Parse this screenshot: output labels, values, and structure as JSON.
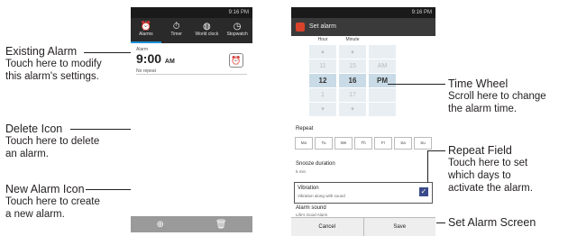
{
  "annotations": {
    "existing_alarm": {
      "title": "Existing Alarm",
      "desc1": "Touch here to modify",
      "desc2": "this alarm's settings."
    },
    "delete_icon": {
      "title": "Delete Icon",
      "desc1": "Touch here to delete",
      "desc2": "an alarm."
    },
    "new_alarm_icon": {
      "title": "New Alarm Icon",
      "desc1": "Touch here to create",
      "desc2": "a new alarm."
    },
    "time_wheel": {
      "title": "Time Wheel",
      "desc1": "Scroll here to change",
      "desc2": "the alarm time."
    },
    "repeat_field": {
      "title": "Repeat Field",
      "desc1": "Touch here to set",
      "desc2": "which days to",
      "desc3": "activate the alarm."
    },
    "set_alarm_screen": {
      "title": "Set Alarm Screen"
    }
  },
  "phone1": {
    "status": "9:16 PM",
    "tabs": [
      {
        "label": "Alarms",
        "icon": "alarm-clock-icon"
      },
      {
        "label": "Timer",
        "icon": "timer-icon"
      },
      {
        "label": "World clock",
        "icon": "globe-icon"
      },
      {
        "label": "Stopwatch",
        "icon": "stopwatch-icon"
      }
    ],
    "alarm": {
      "label": "Alarm",
      "time": "9:00",
      "ampm": "AM",
      "repeat": "No repeat"
    }
  },
  "phone2": {
    "status": "9:16 PM",
    "title": "Set alarm",
    "wheel": {
      "hour_header": "Hour",
      "minute_header": "Minute",
      "hours": [
        "",
        "11",
        "12",
        "1",
        ""
      ],
      "minutes": [
        "",
        "15",
        "16",
        "17",
        ""
      ],
      "ampm": [
        "",
        "AM",
        "PM",
        "",
        ""
      ]
    },
    "repeat_label": "Repeat",
    "days": [
      "Mo",
      "Tu",
      "We",
      "Th",
      "Fr",
      "Sa",
      "Su"
    ],
    "snooze_label": "Snooze duration",
    "snooze_value": "5 min",
    "vibration_label": "Vibration",
    "vibration_value": "Vibration along with sound",
    "sound_label": "Alarm sound",
    "sound_value": "Life's Good Alarm",
    "cancel": "Cancel",
    "save": "Save"
  },
  "colors": {
    "accent": "#1d8fd6",
    "header": "#2a2a2a",
    "wheel_selected": "#c8dbe6"
  }
}
